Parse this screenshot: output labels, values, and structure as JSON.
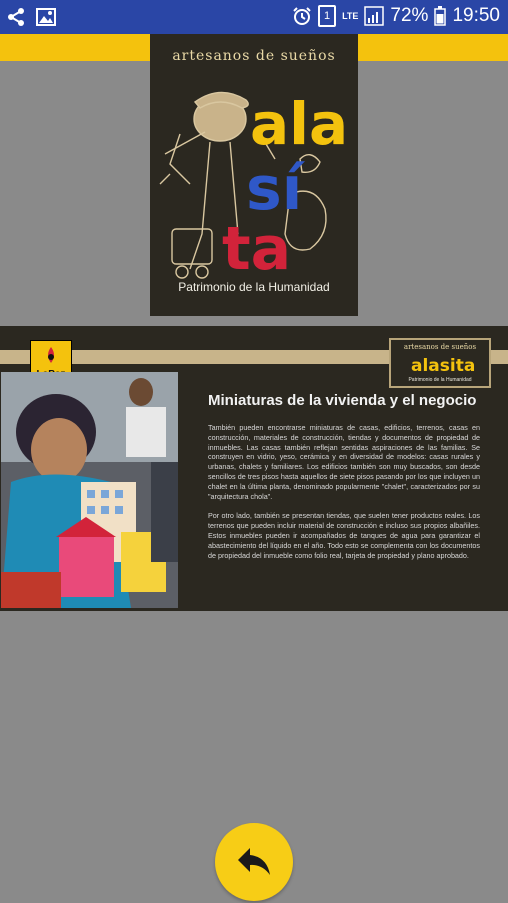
{
  "status_bar": {
    "left_icons": [
      "share-icon",
      "image-icon"
    ],
    "right_icons": [
      "alarm-icon",
      "sim-icon",
      "lte-icon",
      "signal-icon",
      "battery-icon"
    ],
    "sim_label": "1",
    "lte_label": "LTE",
    "battery": "72%",
    "time": "19:50"
  },
  "cover": {
    "subtitle": "artesanos de sueños",
    "word_top": "ala",
    "word_middle": "sí",
    "word_bottom": "ta",
    "tagline": "Patrimonio de la Humanidad"
  },
  "page": {
    "badge_label": "LaPaz",
    "mini_logo_top": "artesanos de sueños",
    "mini_logo_word": "alasita",
    "mini_logo_bottom": "Patrimonio de la Humanidad",
    "title": "Miniaturas de la vivienda y el negocio",
    "paragraph_1": "También pueden encontrarse miniaturas de casas, edificios, terrenos, casas en construcción, materiales de construcción, tiendas y documentos de propiedad de inmuebles. Las casas también reflejan sentidas aspiraciones de las familias. Se construyen en vidrio, yeso, cerámica y en diversidad de modelos: casas rurales y urbanas, chalets y familiares. Los edificios también son muy buscados, son desde sencillos de tres pisos hasta aquellos de siete pisos pasando por los que incluyen un chalet en la última planta, denominado popularmente \"chalet\", caracterizados por su \"arquitectura chola\".",
    "paragraph_2": "Por otro lado, también se presentan tiendas, que suelen tener productos reales. Los terrenos que pueden incluir material de construcción e incluso sus propios albañiles. Estos inmuebles pueden ir acompañados de tanques de agua para garantizar el abastecimiento del líquido en el año. Todo esto se complementa con los documentos de propiedad del inmueble como folio real, tarjeta de propiedad y plano aprobado."
  },
  "back_button": {
    "icon": "reply-arrow-icon"
  },
  "colors": {
    "status_bar": "#2a46a6",
    "accent_yellow": "#f4c20d",
    "panel_dark": "#2b2820",
    "background": "#8a8a8a"
  }
}
